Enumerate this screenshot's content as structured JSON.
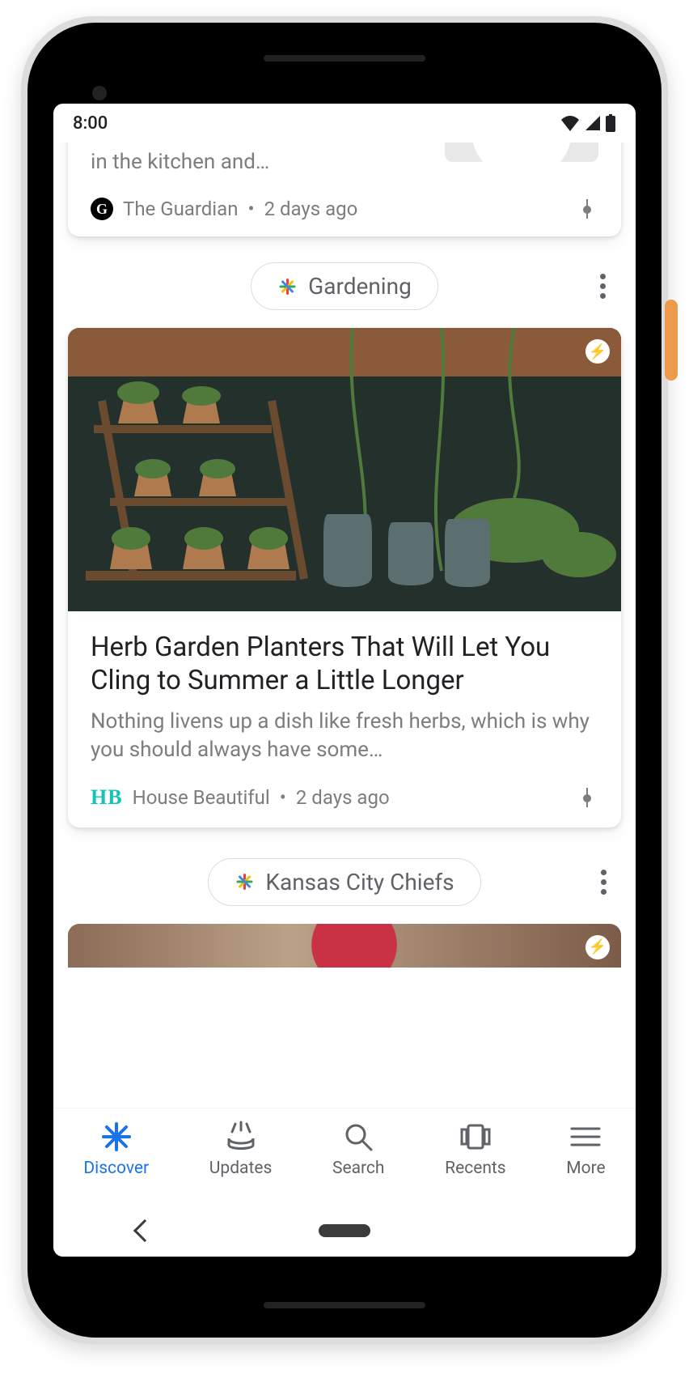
{
  "statusbar": {
    "time": "8:00"
  },
  "cards": {
    "prev": {
      "snippet": "The River Cafe chef on his mentors in the kitchen and…",
      "source": "The Guardian",
      "age": "2 days ago"
    },
    "main": {
      "topic_label": "Gardening",
      "headline": "Herb Garden Planters That Will Let You Cling to Summer a Little Longer",
      "snippet": "Nothing livens up a dish like fresh herbs, which is why you should always have some…",
      "source": "House Beautiful",
      "source_logo_text": "HB",
      "age": "2 days ago"
    },
    "next": {
      "topic_label": "Kansas City Chiefs"
    }
  },
  "nav": {
    "items": [
      {
        "label": "Discover",
        "active": true
      },
      {
        "label": "Updates"
      },
      {
        "label": "Search"
      },
      {
        "label": "Recents"
      },
      {
        "label": "More"
      }
    ]
  }
}
